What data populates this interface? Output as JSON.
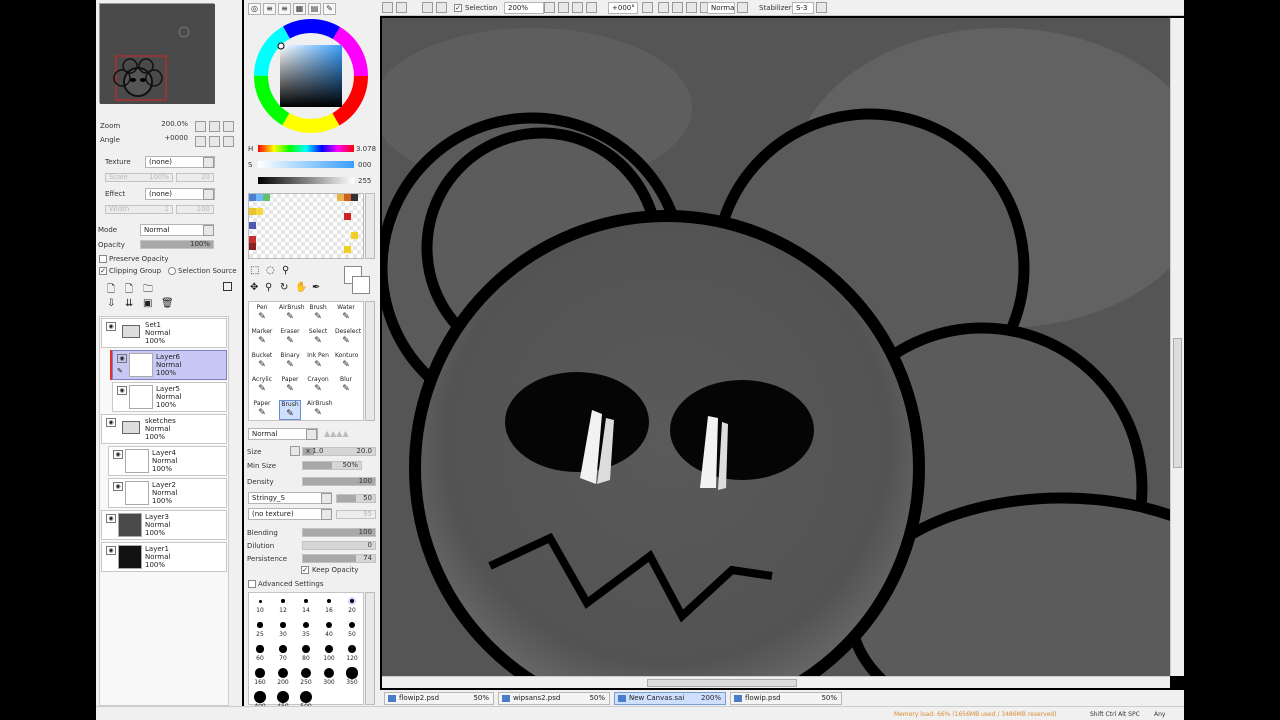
{
  "toolbar": {
    "selection_label": "Selection",
    "zoom": "200%",
    "rotation": "+000°",
    "mode": "Normal",
    "stabilizer_label": "Stabilizer",
    "stabilizer_value": "S-3"
  },
  "navigator": {
    "zoom_label": "Zoom",
    "zoom_value": "200.0%",
    "angle_label": "Angle",
    "angle_value": "+0000"
  },
  "texture": {
    "label": "Texture",
    "value": "(none)",
    "scale_label": "Scale",
    "scale_value": "100%",
    "strength_value": "20"
  },
  "effect": {
    "label": "Effect",
    "value": "(none)",
    "width_label": "Width",
    "width_value": "1",
    "strength_value": "100"
  },
  "layer_props": {
    "mode_label": "Mode",
    "mode_value": "Normal",
    "opacity_label": "Opacity",
    "opacity_value": "100%",
    "preserve_opacity": "Preserve Opacity",
    "clipping_group": "Clipping Group",
    "selection_source": "Selection Source"
  },
  "layers": [
    {
      "name": "Set1",
      "mode": "Normal",
      "opacity": "100%",
      "type": "folder"
    },
    {
      "name": "Layer6",
      "mode": "Normal",
      "opacity": "100%",
      "type": "layer",
      "selected": true
    },
    {
      "name": "Layer5",
      "mode": "Normal",
      "opacity": "100%",
      "type": "layer"
    },
    {
      "name": "sketches",
      "mode": "Normal",
      "opacity": "100%",
      "type": "folder"
    },
    {
      "name": "Layer4",
      "mode": "Normal",
      "opacity": "100%",
      "type": "layer"
    },
    {
      "name": "Layer2",
      "mode": "Normal",
      "opacity": "100%",
      "type": "layer"
    },
    {
      "name": "Layer3",
      "mode": "Normal",
      "opacity": "100%",
      "type": "dark"
    },
    {
      "name": "Layer1",
      "mode": "Normal",
      "opacity": "100%",
      "type": "black"
    }
  ],
  "color": {
    "h_label": "H",
    "h_value": "3.078",
    "s_label": "S",
    "s_value": "000",
    "v_value": "255"
  },
  "tools": [
    {
      "label": "Pen",
      "icon": "pen-icon"
    },
    {
      "label": "AirBrush",
      "icon": "airbrush-icon"
    },
    {
      "label": "Brush",
      "icon": "brush-icon"
    },
    {
      "label": "Water",
      "icon": "water-icon"
    },
    {
      "label": "Marker",
      "icon": "marker-icon"
    },
    {
      "label": "Eraser",
      "icon": "eraser-icon"
    },
    {
      "label": "Select",
      "icon": "select-icon"
    },
    {
      "label": "Deselect",
      "icon": "deselect-icon"
    },
    {
      "label": "Bucket",
      "icon": "bucket-icon"
    },
    {
      "label": "Binary",
      "icon": "binary-icon"
    },
    {
      "label": "Ink Pen",
      "icon": "ink-pen-icon"
    },
    {
      "label": "Konturo",
      "icon": "konturo-icon"
    },
    {
      "label": "Acrylic",
      "icon": "acrylic-icon"
    },
    {
      "label": "Paper",
      "icon": "paper-icon"
    },
    {
      "label": "Crayon",
      "icon": "crayon-icon"
    },
    {
      "label": "Blur",
      "icon": "blur-icon"
    },
    {
      "label": "Paper",
      "icon": "paper-icon"
    },
    {
      "label": "Brush",
      "icon": "brush-icon"
    },
    {
      "label": "AirBrush",
      "icon": "airbrush-icon"
    }
  ],
  "brush": {
    "blend_mode": "Normal",
    "size_label": "Size",
    "size_mult": "x 1.0",
    "size_value": "20.0",
    "min_size_label": "Min Size",
    "min_size_value": "50%",
    "density_label": "Density",
    "density_value": "100",
    "shape": "Stringy_S",
    "shape_value": "50",
    "texture": "(no texture)",
    "texture_value": "95",
    "blending_label": "Blending",
    "blending_value": "100",
    "dilution_label": "Dilution",
    "dilution_value": "0",
    "persistence_label": "Persistence",
    "persistence_value": "74",
    "keep_opacity": "Keep Opacity",
    "advanced_settings": "Advanced Settings"
  },
  "brush_sizes": [
    "10",
    "12",
    "14",
    "16",
    "20",
    "25",
    "30",
    "35",
    "40",
    "50",
    "60",
    "70",
    "80",
    "100",
    "120",
    "160",
    "200",
    "250",
    "300",
    "350",
    "400",
    "450",
    "500"
  ],
  "tabs": [
    {
      "name": "flowip2.psd",
      "zoom": "50%"
    },
    {
      "name": "wipsans2.psd",
      "zoom": "50%"
    },
    {
      "name": "New Canvas.sai",
      "zoom": "200%",
      "active": true
    },
    {
      "name": "flowip.psd",
      "zoom": "50%"
    }
  ],
  "status": {
    "memory": "Memory load: 66% (1656MB used / 3486MB reserved)",
    "keys": "Shift Ctrl Alt SPC",
    "any": "Any"
  },
  "colors": {
    "panel_bg": "#f0f0f0",
    "canvas_bg": "#555555",
    "selected_layer": "#c8c8f4",
    "status_orange": "#d88a30"
  }
}
